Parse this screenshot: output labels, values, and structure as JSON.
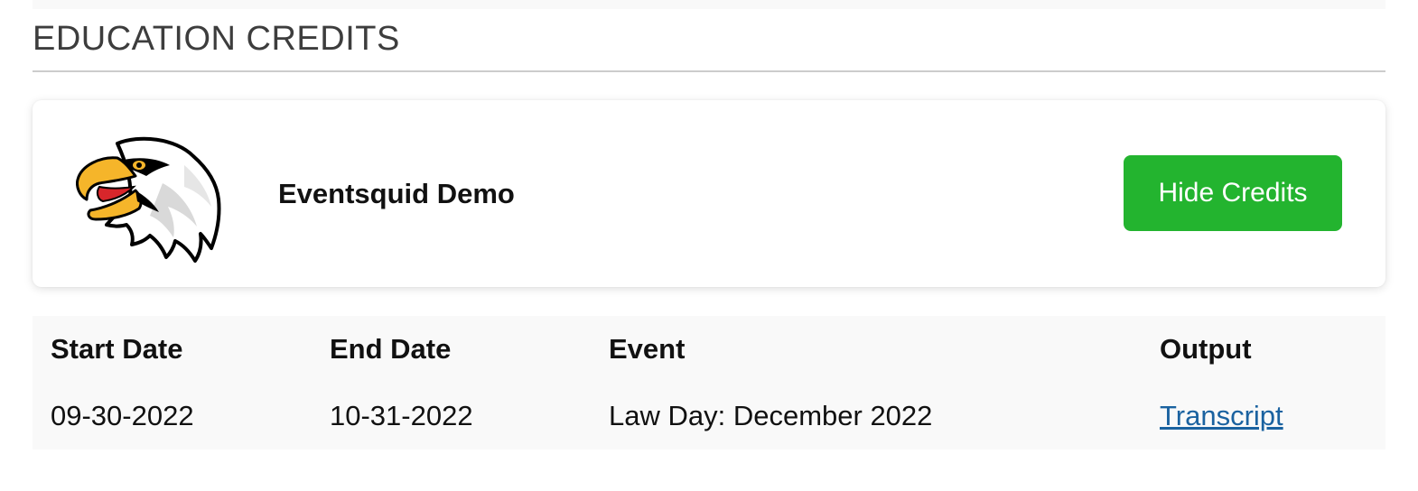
{
  "section": {
    "title": "EDUCATION CREDITS"
  },
  "card": {
    "logo_icon": "eagle-head-logo",
    "org_name": "Eventsquid Demo",
    "hide_button_label": "Hide Credits",
    "button_color": "#23b42f"
  },
  "table": {
    "headers": {
      "start": "Start Date",
      "end": "End Date",
      "event": "Event",
      "output": "Output"
    },
    "rows": [
      {
        "start": "09-30-2022",
        "end": "10-31-2022",
        "event": "Law Day: December 2022",
        "output": "Transcript"
      }
    ]
  },
  "colors": {
    "link": "#1a62a0",
    "title": "#3d3d3d"
  }
}
